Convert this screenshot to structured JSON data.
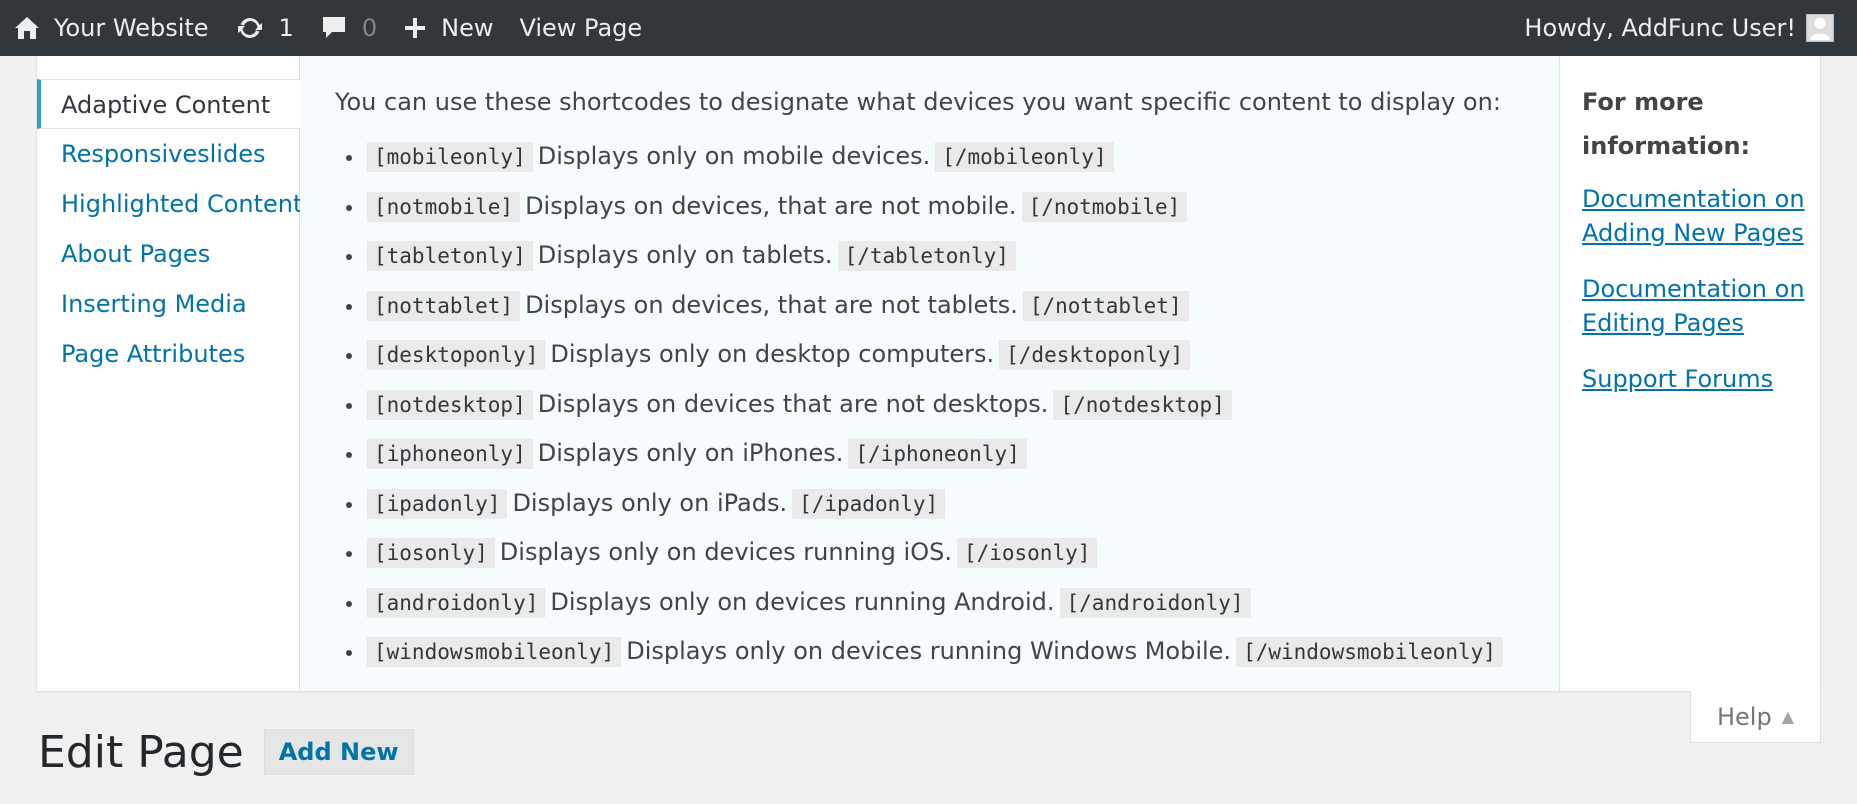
{
  "adminbar": {
    "site_name": "Your Website",
    "updates_count": "1",
    "comments_count": "0",
    "new_label": "New",
    "view_page_label": "View Page",
    "greeting": "Howdy, AddFunc User!"
  },
  "help": {
    "tabs": [
      {
        "label": "Adaptive Content",
        "active": true
      },
      {
        "label": "Responsiveslides",
        "active": false
      },
      {
        "label": "Highlighted Content",
        "active": false
      },
      {
        "label": "About Pages",
        "active": false
      },
      {
        "label": "Inserting Media",
        "active": false
      },
      {
        "label": "Page Attributes",
        "active": false
      }
    ],
    "intro": "You can use these shortcodes to designate what devices you want specific content to display on:",
    "shortcodes": [
      {
        "open": "[mobileonly]",
        "desc": "Displays only on mobile devices.",
        "close": "[/mobileonly]"
      },
      {
        "open": "[notmobile]",
        "desc": "Displays on devices, that are not mobile.",
        "close": "[/notmobile]"
      },
      {
        "open": "[tabletonly]",
        "desc": "Displays only on tablets.",
        "close": "[/tabletonly]"
      },
      {
        "open": "[nottablet]",
        "desc": "Displays on devices, that are not tablets.",
        "close": "[/nottablet]"
      },
      {
        "open": "[desktoponly]",
        "desc": "Displays only on desktop computers.",
        "close": "[/desktoponly]"
      },
      {
        "open": "[notdesktop]",
        "desc": "Displays on devices that are not desktops.",
        "close": "[/notdesktop]"
      },
      {
        "open": "[iphoneonly]",
        "desc": "Displays only on iPhones.",
        "close": "[/iphoneonly]"
      },
      {
        "open": "[ipadonly]",
        "desc": "Displays only on iPads.",
        "close": "[/ipadonly]"
      },
      {
        "open": "[iosonly]",
        "desc": "Displays only on devices running iOS.",
        "close": "[/iosonly]"
      },
      {
        "open": "[androidonly]",
        "desc": "Displays only on devices running Android.",
        "close": "[/androidonly]"
      },
      {
        "open": "[windowsmobileonly]",
        "desc": "Displays only on devices running Windows Mobile.",
        "close": "[/windowsmobileonly]"
      }
    ],
    "sidebar": {
      "heading": "For more information:",
      "links": [
        "Documentation on Adding New Pages",
        "Documentation on Editing Pages",
        "Support Forums"
      ]
    },
    "toggle_label": "Help",
    "toggle_arrow": "▲"
  },
  "page": {
    "title": "Edit Page",
    "add_new_label": "Add New"
  },
  "colors": {
    "adminbar_bg": "#32373c",
    "link": "#0073aa",
    "active_tab_border": "#2ea2cc",
    "content_bg": "#f6fbfd",
    "page_bg": "#f1f1f1"
  },
  "icons": {
    "home": "home-icon",
    "updates": "updates-icon",
    "comments": "comment-icon",
    "new": "plus-icon",
    "avatar": "avatar-icon"
  }
}
